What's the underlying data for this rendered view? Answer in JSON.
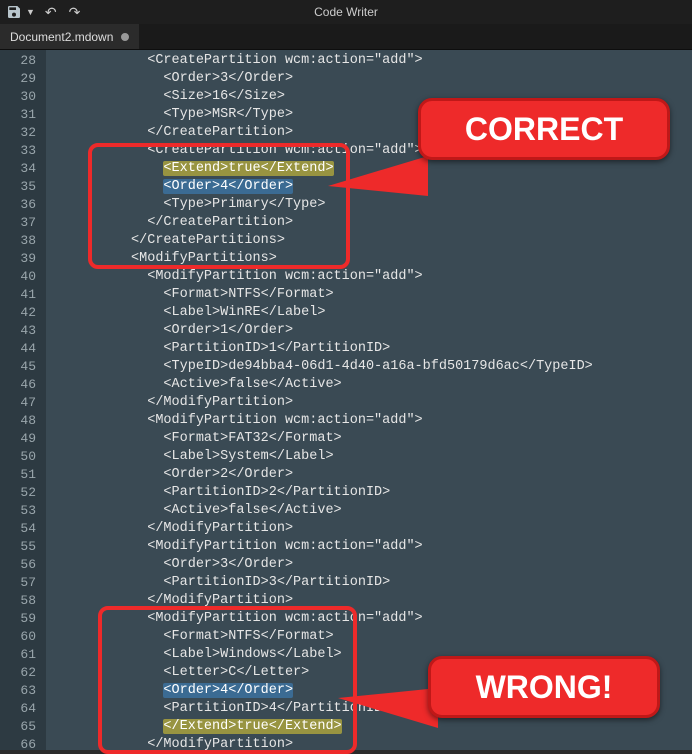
{
  "app": {
    "title": "Code Writer"
  },
  "tab": {
    "filename": "Document2.mdown",
    "dirty": true
  },
  "gutter": {
    "start": 28,
    "end": 66
  },
  "code": {
    "lines": [
      {
        "indent": 6,
        "content": "<CreatePartition wcm:action=\"add\">"
      },
      {
        "indent": 7,
        "content": "<Order>3</Order>"
      },
      {
        "indent": 7,
        "content": "<Size>16</Size>"
      },
      {
        "indent": 7,
        "content": "<Type>MSR</Type>"
      },
      {
        "indent": 6,
        "content": "</CreatePartition>"
      },
      {
        "indent": 6,
        "content": "<CreatePartition wcm:action=\"add\">"
      },
      {
        "indent": 7,
        "content": "<Extend>true</Extend>",
        "hl": "yellow"
      },
      {
        "indent": 7,
        "content": "<Order>4</Order>",
        "hl": "blue"
      },
      {
        "indent": 7,
        "content": "<Type>Primary</Type>"
      },
      {
        "indent": 6,
        "content": "</CreatePartition>"
      },
      {
        "indent": 5,
        "content": "</CreatePartitions>"
      },
      {
        "indent": 5,
        "content": "<ModifyPartitions>"
      },
      {
        "indent": 6,
        "content": "<ModifyPartition wcm:action=\"add\">"
      },
      {
        "indent": 7,
        "content": "<Format>NTFS</Format>"
      },
      {
        "indent": 7,
        "content": "<Label>WinRE</Label>"
      },
      {
        "indent": 7,
        "content": "<Order>1</Order>"
      },
      {
        "indent": 7,
        "content": "<PartitionID>1</PartitionID>"
      },
      {
        "indent": 7,
        "content": "<TypeID>de94bba4-06d1-4d40-a16a-bfd50179d6ac</TypeID>"
      },
      {
        "indent": 7,
        "content": "<Active>false</Active>"
      },
      {
        "indent": 6,
        "content": "</ModifyPartition>"
      },
      {
        "indent": 6,
        "content": "<ModifyPartition wcm:action=\"add\">"
      },
      {
        "indent": 7,
        "content": "<Format>FAT32</Format>"
      },
      {
        "indent": 7,
        "content": "<Label>System</Label>"
      },
      {
        "indent": 7,
        "content": "<Order>2</Order>"
      },
      {
        "indent": 7,
        "content": "<PartitionID>2</PartitionID>"
      },
      {
        "indent": 7,
        "content": "<Active>false</Active>"
      },
      {
        "indent": 6,
        "content": "</ModifyPartition>"
      },
      {
        "indent": 6,
        "content": "<ModifyPartition wcm:action=\"add\">"
      },
      {
        "indent": 7,
        "content": "<Order>3</Order>"
      },
      {
        "indent": 7,
        "content": "<PartitionID>3</PartitionID>"
      },
      {
        "indent": 6,
        "content": "</ModifyPartition>"
      },
      {
        "indent": 6,
        "content": "<ModifyPartition wcm:action=\"add\">"
      },
      {
        "indent": 7,
        "content": "<Format>NTFS</Format>"
      },
      {
        "indent": 7,
        "content": "<Label>Windows</Label>"
      },
      {
        "indent": 7,
        "content": "<Letter>C</Letter>"
      },
      {
        "indent": 7,
        "content": "<Order>4</Order>",
        "hl": "blue"
      },
      {
        "indent": 7,
        "content": "<PartitionID>4</PartitionID>"
      },
      {
        "indent": 7,
        "content": "</Extend>true</Extend>",
        "hl": "yellow"
      },
      {
        "indent": 6,
        "content": "</ModifyPartition>"
      }
    ]
  },
  "callouts": {
    "correct": {
      "label": "CORRECT"
    },
    "wrong": {
      "label": "WRONG!"
    }
  }
}
